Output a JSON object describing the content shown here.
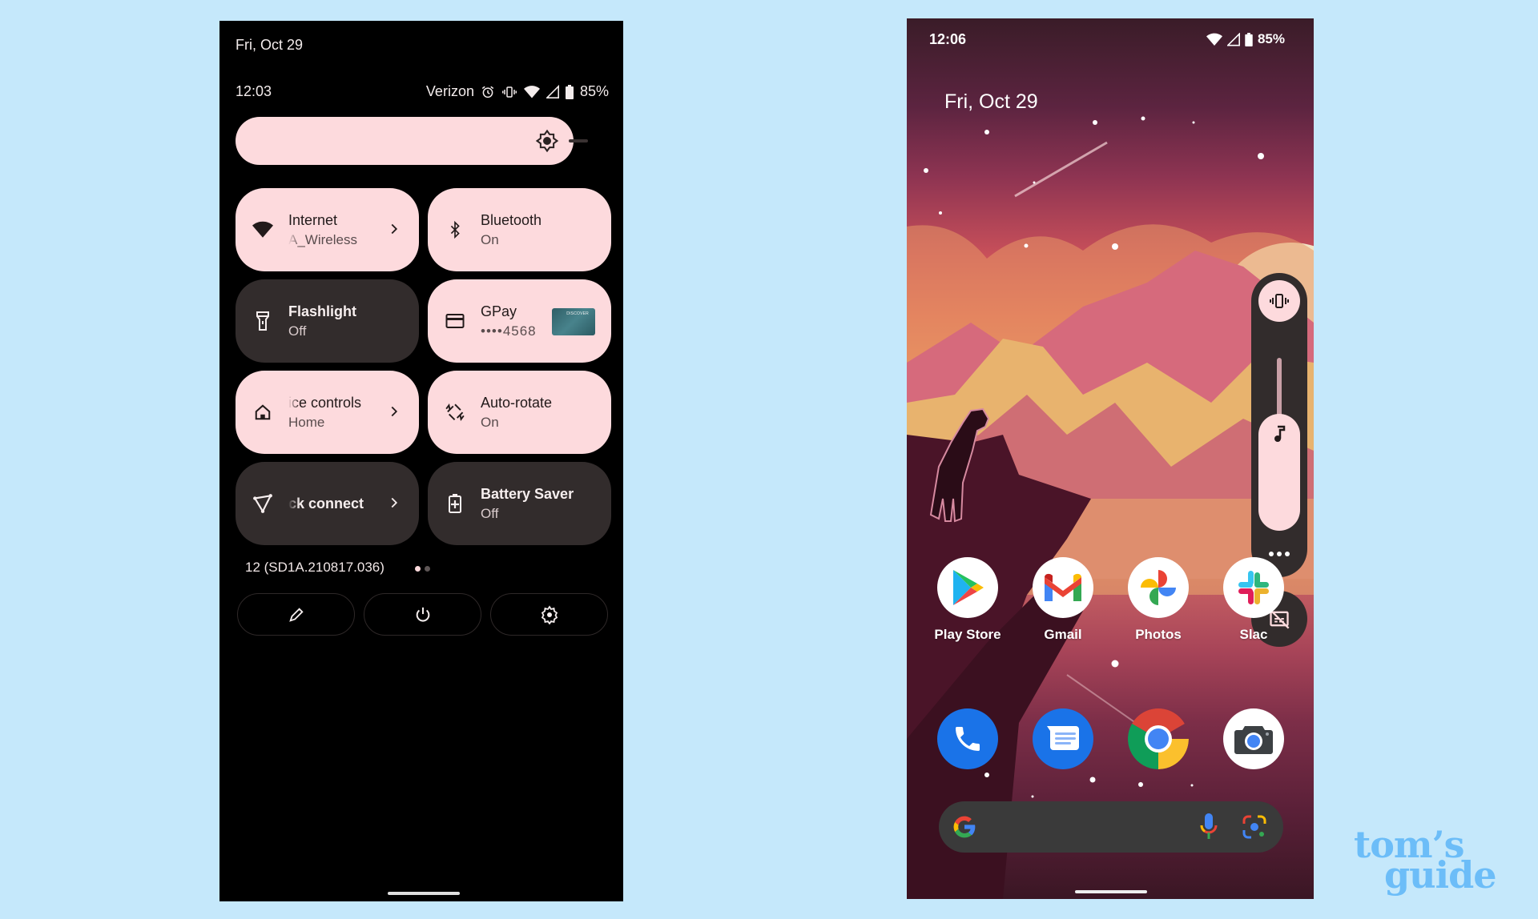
{
  "quick_settings": {
    "date": "Fri, Oct 29",
    "time": "12:03",
    "carrier": "Verizon",
    "status_icons": [
      "alarm-icon",
      "vibrate-icon",
      "wifi-icon",
      "cellular-signal-icon",
      "battery-icon"
    ],
    "battery": "85%",
    "brightness_level": 0.92,
    "tiles": [
      {
        "label": "Internet",
        "sub": "A_Wireless",
        "state": "on",
        "icon": "wifi-icon",
        "chevron": true
      },
      {
        "label": "Bluetooth",
        "sub": "On",
        "state": "on",
        "icon": "bluetooth-icon",
        "chevron": false
      },
      {
        "label": "Flashlight",
        "sub": "Off",
        "state": "off",
        "icon": "flashlight-icon",
        "chevron": false
      },
      {
        "label": "GPay",
        "sub_mask": "••••",
        "sub_last4": "4568",
        "state": "on",
        "icon": "credit-card-icon",
        "card_brand": "DISCOVER"
      },
      {
        "label": "ice controls",
        "sub": "Home",
        "state": "on",
        "icon": "home-icon",
        "chevron": true
      },
      {
        "label": "Auto-rotate",
        "sub": "On",
        "state": "on",
        "icon": "auto-rotate-icon",
        "chevron": false
      },
      {
        "label": "ck connect",
        "state": "off",
        "icon": "nearby-share-icon",
        "chevron": true
      },
      {
        "label": "Battery Saver",
        "sub": "Off",
        "state": "off",
        "icon": "battery-saver-icon",
        "chevron": false
      }
    ],
    "build_number": "12 (SD1A.210817.036)",
    "pages": 2,
    "current_page": 1,
    "footer_buttons": [
      "edit-icon",
      "power-icon",
      "settings-icon"
    ]
  },
  "home_screen": {
    "time": "12:06",
    "battery": "85%",
    "date": "Fri, Oct 29",
    "volume": {
      "ringer_mode": "vibrate",
      "media_level": 0.55
    },
    "apps_row1": [
      {
        "label": "Play Store"
      },
      {
        "label": "Gmail"
      },
      {
        "label": "Photos"
      },
      {
        "label": "Slac"
      }
    ],
    "dock": [
      "Phone",
      "Messages",
      "Chrome",
      "Camera"
    ]
  },
  "watermark": {
    "line1": "tom’s",
    "line2": "guide"
  },
  "colors": {
    "tile_on": "#fddadd",
    "tile_off": "#322c2c",
    "page_bg": "#c5e8fb",
    "watermark": "#6cbdf8"
  }
}
